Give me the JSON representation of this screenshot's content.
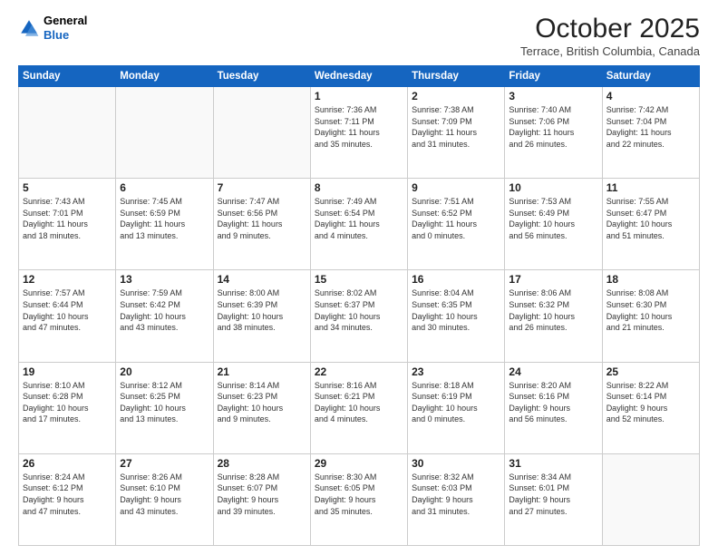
{
  "logo": {
    "line1": "General",
    "line2": "Blue"
  },
  "title": "October 2025",
  "subtitle": "Terrace, British Columbia, Canada",
  "header": {
    "days": [
      "Sunday",
      "Monday",
      "Tuesday",
      "Wednesday",
      "Thursday",
      "Friday",
      "Saturday"
    ]
  },
  "weeks": [
    [
      {
        "day": "",
        "info": ""
      },
      {
        "day": "",
        "info": ""
      },
      {
        "day": "",
        "info": ""
      },
      {
        "day": "1",
        "info": "Sunrise: 7:36 AM\nSunset: 7:11 PM\nDaylight: 11 hours\nand 35 minutes."
      },
      {
        "day": "2",
        "info": "Sunrise: 7:38 AM\nSunset: 7:09 PM\nDaylight: 11 hours\nand 31 minutes."
      },
      {
        "day": "3",
        "info": "Sunrise: 7:40 AM\nSunset: 7:06 PM\nDaylight: 11 hours\nand 26 minutes."
      },
      {
        "day": "4",
        "info": "Sunrise: 7:42 AM\nSunset: 7:04 PM\nDaylight: 11 hours\nand 22 minutes."
      }
    ],
    [
      {
        "day": "5",
        "info": "Sunrise: 7:43 AM\nSunset: 7:01 PM\nDaylight: 11 hours\nand 18 minutes."
      },
      {
        "day": "6",
        "info": "Sunrise: 7:45 AM\nSunset: 6:59 PM\nDaylight: 11 hours\nand 13 minutes."
      },
      {
        "day": "7",
        "info": "Sunrise: 7:47 AM\nSunset: 6:56 PM\nDaylight: 11 hours\nand 9 minutes."
      },
      {
        "day": "8",
        "info": "Sunrise: 7:49 AM\nSunset: 6:54 PM\nDaylight: 11 hours\nand 4 minutes."
      },
      {
        "day": "9",
        "info": "Sunrise: 7:51 AM\nSunset: 6:52 PM\nDaylight: 11 hours\nand 0 minutes."
      },
      {
        "day": "10",
        "info": "Sunrise: 7:53 AM\nSunset: 6:49 PM\nDaylight: 10 hours\nand 56 minutes."
      },
      {
        "day": "11",
        "info": "Sunrise: 7:55 AM\nSunset: 6:47 PM\nDaylight: 10 hours\nand 51 minutes."
      }
    ],
    [
      {
        "day": "12",
        "info": "Sunrise: 7:57 AM\nSunset: 6:44 PM\nDaylight: 10 hours\nand 47 minutes."
      },
      {
        "day": "13",
        "info": "Sunrise: 7:59 AM\nSunset: 6:42 PM\nDaylight: 10 hours\nand 43 minutes."
      },
      {
        "day": "14",
        "info": "Sunrise: 8:00 AM\nSunset: 6:39 PM\nDaylight: 10 hours\nand 38 minutes."
      },
      {
        "day": "15",
        "info": "Sunrise: 8:02 AM\nSunset: 6:37 PM\nDaylight: 10 hours\nand 34 minutes."
      },
      {
        "day": "16",
        "info": "Sunrise: 8:04 AM\nSunset: 6:35 PM\nDaylight: 10 hours\nand 30 minutes."
      },
      {
        "day": "17",
        "info": "Sunrise: 8:06 AM\nSunset: 6:32 PM\nDaylight: 10 hours\nand 26 minutes."
      },
      {
        "day": "18",
        "info": "Sunrise: 8:08 AM\nSunset: 6:30 PM\nDaylight: 10 hours\nand 21 minutes."
      }
    ],
    [
      {
        "day": "19",
        "info": "Sunrise: 8:10 AM\nSunset: 6:28 PM\nDaylight: 10 hours\nand 17 minutes."
      },
      {
        "day": "20",
        "info": "Sunrise: 8:12 AM\nSunset: 6:25 PM\nDaylight: 10 hours\nand 13 minutes."
      },
      {
        "day": "21",
        "info": "Sunrise: 8:14 AM\nSunset: 6:23 PM\nDaylight: 10 hours\nand 9 minutes."
      },
      {
        "day": "22",
        "info": "Sunrise: 8:16 AM\nSunset: 6:21 PM\nDaylight: 10 hours\nand 4 minutes."
      },
      {
        "day": "23",
        "info": "Sunrise: 8:18 AM\nSunset: 6:19 PM\nDaylight: 10 hours\nand 0 minutes."
      },
      {
        "day": "24",
        "info": "Sunrise: 8:20 AM\nSunset: 6:16 PM\nDaylight: 9 hours\nand 56 minutes."
      },
      {
        "day": "25",
        "info": "Sunrise: 8:22 AM\nSunset: 6:14 PM\nDaylight: 9 hours\nand 52 minutes."
      }
    ],
    [
      {
        "day": "26",
        "info": "Sunrise: 8:24 AM\nSunset: 6:12 PM\nDaylight: 9 hours\nand 47 minutes."
      },
      {
        "day": "27",
        "info": "Sunrise: 8:26 AM\nSunset: 6:10 PM\nDaylight: 9 hours\nand 43 minutes."
      },
      {
        "day": "28",
        "info": "Sunrise: 8:28 AM\nSunset: 6:07 PM\nDaylight: 9 hours\nand 39 minutes."
      },
      {
        "day": "29",
        "info": "Sunrise: 8:30 AM\nSunset: 6:05 PM\nDaylight: 9 hours\nand 35 minutes."
      },
      {
        "day": "30",
        "info": "Sunrise: 8:32 AM\nSunset: 6:03 PM\nDaylight: 9 hours\nand 31 minutes."
      },
      {
        "day": "31",
        "info": "Sunrise: 8:34 AM\nSunset: 6:01 PM\nDaylight: 9 hours\nand 27 minutes."
      },
      {
        "day": "",
        "info": ""
      }
    ]
  ]
}
